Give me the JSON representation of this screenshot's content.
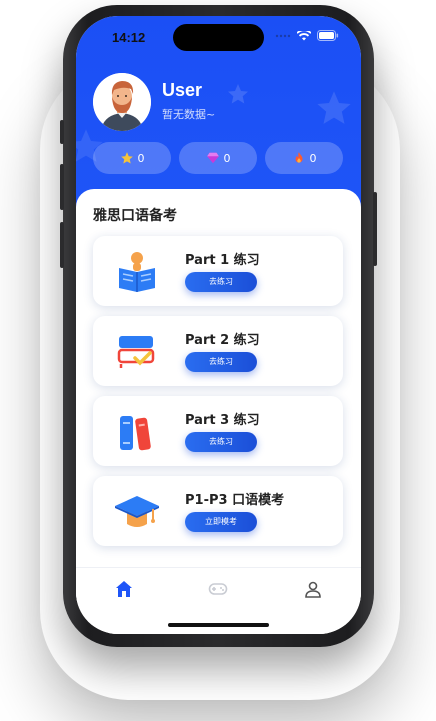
{
  "status_bar": {
    "time": "14:12"
  },
  "profile": {
    "username": "User",
    "subtitle": "暂无数据~"
  },
  "stats": [
    {
      "icon": "star-icon",
      "value": "0"
    },
    {
      "icon": "gem-icon",
      "value": "0"
    },
    {
      "icon": "flame-icon",
      "value": "0"
    }
  ],
  "section_title": "雅思口语备考",
  "cards": [
    {
      "title": "Part 1 练习",
      "button": "去练习",
      "icon": "reading-person-icon"
    },
    {
      "title": "Part 2 练习",
      "button": "去练习",
      "icon": "books-check-icon"
    },
    {
      "title": "Part 3 练习",
      "button": "去练习",
      "icon": "books-stack-icon"
    },
    {
      "title": "P1-P3 口语模考",
      "button": "立即模考",
      "icon": "graduation-cap-icon"
    }
  ],
  "tabbar": [
    {
      "icon": "home-icon",
      "active": true
    },
    {
      "icon": "gamepad-icon",
      "active": false
    },
    {
      "icon": "user-icon",
      "active": false
    }
  ],
  "colors": {
    "primary": "#1f55f7",
    "button": "#2a6df0",
    "star": "#f5c33b",
    "gem": "#c93ad8",
    "flame": "#ff5a2e"
  }
}
